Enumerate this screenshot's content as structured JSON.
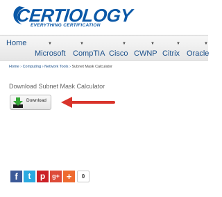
{
  "brand": {
    "logo_text": "CERTIOLOGY",
    "tagline": "EVERYTHING CERTIFICATION",
    "color": "#0b58a7"
  },
  "nav": {
    "items": [
      "Home",
      "Microsoft",
      "CompTIA",
      "Cisco",
      "CWNP",
      "Citrix",
      "Oracle"
    ],
    "caret_icon": "caret-down-icon"
  },
  "breadcrumb": {
    "items": [
      "Home",
      "Computing",
      "Network Tools",
      "Subnet Mask Calculator"
    ],
    "separator": "›"
  },
  "page": {
    "title": "Download Subnet Mask Calculator",
    "download_button_label": "Download",
    "download_icon": "download-arrow-icon",
    "annotation_arrow_color": "#d9342b"
  },
  "share": {
    "buttons": [
      {
        "name": "facebook-icon",
        "glyph": "f",
        "color": "#3b5998"
      },
      {
        "name": "twitter-icon",
        "glyph": "t",
        "color": "#2aa9e0"
      },
      {
        "name": "pinterest-icon",
        "glyph": "p",
        "color": "#cb2027"
      },
      {
        "name": "google-plus-icon",
        "glyph": "g+",
        "color": "#dd4b39"
      },
      {
        "name": "more-share-icon",
        "glyph": "+",
        "color": "#ee6a2f"
      }
    ],
    "count": "0"
  }
}
